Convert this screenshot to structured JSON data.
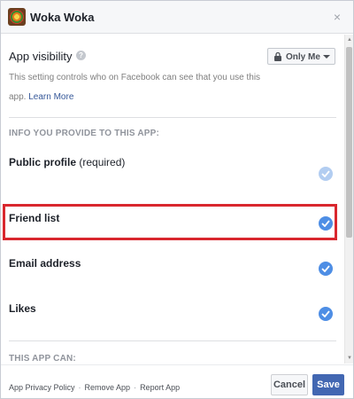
{
  "header": {
    "app_name": "Woka Woka",
    "close_glyph": "×"
  },
  "visibility": {
    "label": "App visibility",
    "help_glyph": "?",
    "description": "This setting controls who on Facebook can see that you use this app.",
    "learn_more": "Learn More",
    "selected_audience": "Only Me"
  },
  "info_section": {
    "heading": "INFO YOU PROVIDE TO THIS APP:",
    "items": [
      {
        "label": "Public profile",
        "note": "(required)",
        "checked": true,
        "disabled": true
      },
      {
        "label": "Friend list",
        "note": "",
        "checked": true,
        "disabled": false
      },
      {
        "label": "Email address",
        "note": "",
        "checked": true,
        "disabled": false
      },
      {
        "label": "Likes",
        "note": "",
        "checked": true,
        "disabled": false
      }
    ]
  },
  "can_section": {
    "heading": "THIS APP CAN:"
  },
  "footer": {
    "links": [
      "App Privacy Policy",
      "Remove App",
      "Report App"
    ],
    "separator": "·",
    "cancel_label": "Cancel",
    "save_label": "Save"
  },
  "colors": {
    "accent": "#4267b2",
    "check": "#4e8ee5",
    "highlight": "#d9272e"
  }
}
